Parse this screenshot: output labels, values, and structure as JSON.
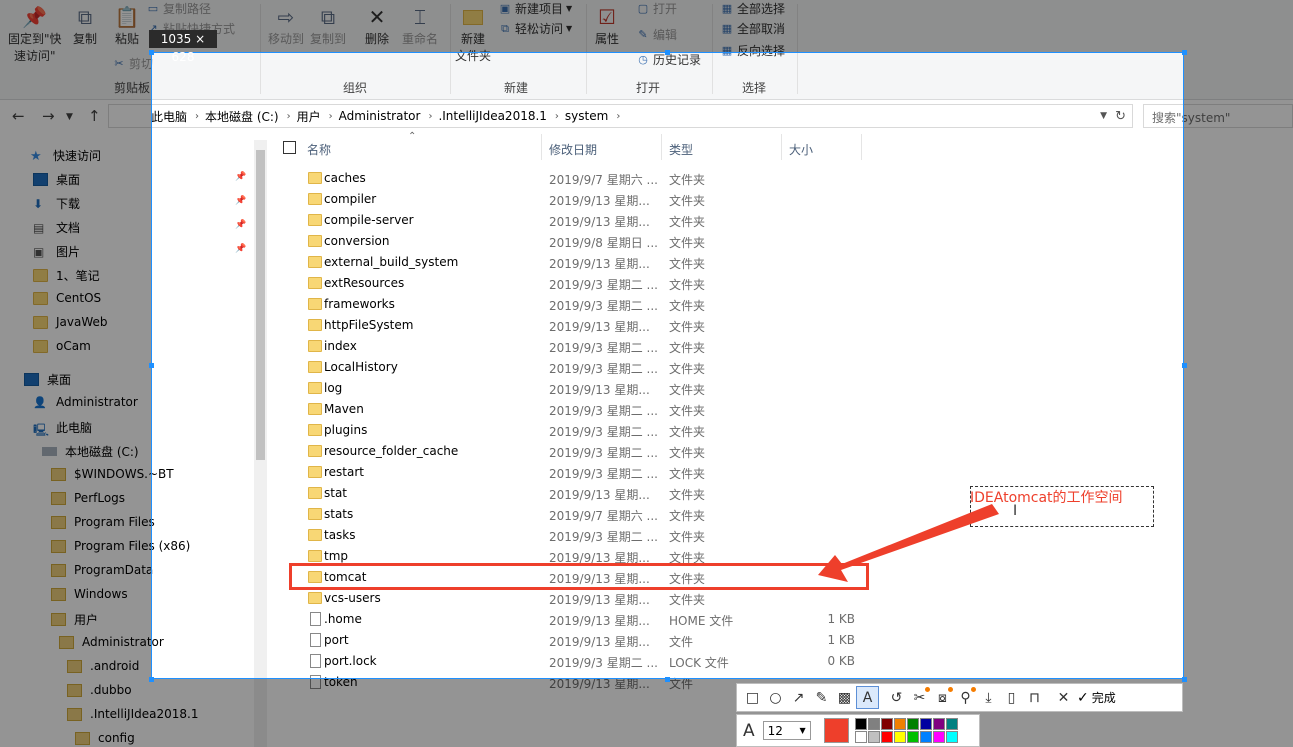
{
  "ribbon": {
    "pin_label1": "固定到\"快",
    "pin_label2": "速访问\"",
    "copy": "复制",
    "paste": "粘贴",
    "copy_path": "复制路径",
    "paste_shortcut": "粘贴快捷方式",
    "cut": "剪切",
    "clipboard_group": "剪贴板",
    "move_to": "移动到",
    "copy_to": "复制到",
    "delete": "删除",
    "rename": "重命名",
    "organize_group": "组织",
    "new_folder1": "新建",
    "new_folder2": "文件夹",
    "new_item": "新建项目",
    "easy_access": "轻松访问",
    "new_group": "新建",
    "properties": "属性",
    "open": "打开",
    "edit": "编辑",
    "history": "历史记录",
    "open_group": "打开",
    "select_all": "全部选择",
    "select_none": "全部取消",
    "invert": "反向选择",
    "select_group": "选择"
  },
  "address": {
    "crumbs": [
      "此电脑",
      "本地磁盘 (C:)",
      "用户",
      "Administrator",
      ".IntelliJIdea2018.1",
      "system"
    ],
    "search_placeholder": "搜索\"system\""
  },
  "nav": [
    {
      "label": "快速访问",
      "icon": "star-icon",
      "pinned": false
    },
    {
      "label": "桌面",
      "icon": "desktop-icon",
      "pinned": true
    },
    {
      "label": "下载",
      "icon": "download-icon",
      "pinned": true
    },
    {
      "label": "文档",
      "icon": "document-icon",
      "pinned": true
    },
    {
      "label": "图片",
      "icon": "picture-icon",
      "pinned": true
    },
    {
      "label": "1、笔记",
      "icon": "folder-icon",
      "pinned": false
    },
    {
      "label": "CentOS",
      "icon": "folder-icon",
      "pinned": false
    },
    {
      "label": "JavaWeb",
      "icon": "folder-icon",
      "pinned": false
    },
    {
      "label": "oCam",
      "icon": "folder-icon",
      "pinned": false
    },
    {
      "label": "桌面",
      "icon": "desktop-icon",
      "pinned": false
    },
    {
      "label": "Administrator",
      "icon": "user-icon",
      "pinned": false
    },
    {
      "label": "此电脑",
      "icon": "computer-icon",
      "pinned": false
    },
    {
      "label": "本地磁盘 (C:)",
      "icon": "drive-icon",
      "pinned": false
    },
    {
      "label": "$WINDOWS.~BT",
      "icon": "folder-icon",
      "pinned": false
    },
    {
      "label": "PerfLogs",
      "icon": "folder-icon",
      "pinned": false
    },
    {
      "label": "Program Files",
      "icon": "folder-icon",
      "pinned": false
    },
    {
      "label": "Program Files (x86)",
      "icon": "folder-icon",
      "pinned": false
    },
    {
      "label": "ProgramData",
      "icon": "folder-icon",
      "pinned": false
    },
    {
      "label": "Windows",
      "icon": "folder-icon",
      "pinned": false
    },
    {
      "label": "用户",
      "icon": "folder-icon",
      "pinned": false
    },
    {
      "label": "Administrator",
      "icon": "folder-icon",
      "pinned": false
    },
    {
      "label": ".android",
      "icon": "folder-icon",
      "pinned": false
    },
    {
      "label": ".dubbo",
      "icon": "folder-icon",
      "pinned": false
    },
    {
      "label": ".IntelliJIdea2018.1",
      "icon": "folder-icon",
      "pinned": false
    },
    {
      "label": "config",
      "icon": "folder-icon",
      "pinned": false
    }
  ],
  "columns": {
    "name": "名称",
    "date": "修改日期",
    "type": "类型",
    "size": "大小"
  },
  "files": [
    {
      "name": "caches",
      "date": "2019/9/7 星期六 ...",
      "type": "文件夹",
      "size": "",
      "kind": "folder"
    },
    {
      "name": "compiler",
      "date": "2019/9/13 星期...",
      "type": "文件夹",
      "size": "",
      "kind": "folder"
    },
    {
      "name": "compile-server",
      "date": "2019/9/13 星期...",
      "type": "文件夹",
      "size": "",
      "kind": "folder"
    },
    {
      "name": "conversion",
      "date": "2019/9/8 星期日 ...",
      "type": "文件夹",
      "size": "",
      "kind": "folder"
    },
    {
      "name": "external_build_system",
      "date": "2019/9/13 星期...",
      "type": "文件夹",
      "size": "",
      "kind": "folder"
    },
    {
      "name": "extResources",
      "date": "2019/9/3 星期二 ...",
      "type": "文件夹",
      "size": "",
      "kind": "folder"
    },
    {
      "name": "frameworks",
      "date": "2019/9/3 星期二 ...",
      "type": "文件夹",
      "size": "",
      "kind": "folder"
    },
    {
      "name": "httpFileSystem",
      "date": "2019/9/13 星期...",
      "type": "文件夹",
      "size": "",
      "kind": "folder"
    },
    {
      "name": "index",
      "date": "2019/9/3 星期二 ...",
      "type": "文件夹",
      "size": "",
      "kind": "folder"
    },
    {
      "name": "LocalHistory",
      "date": "2019/9/3 星期二 ...",
      "type": "文件夹",
      "size": "",
      "kind": "folder"
    },
    {
      "name": "log",
      "date": "2019/9/13 星期...",
      "type": "文件夹",
      "size": "",
      "kind": "folder"
    },
    {
      "name": "Maven",
      "date": "2019/9/3 星期二 ...",
      "type": "文件夹",
      "size": "",
      "kind": "folder"
    },
    {
      "name": "plugins",
      "date": "2019/9/3 星期二 ...",
      "type": "文件夹",
      "size": "",
      "kind": "folder"
    },
    {
      "name": "resource_folder_cache",
      "date": "2019/9/3 星期二 ...",
      "type": "文件夹",
      "size": "",
      "kind": "folder"
    },
    {
      "name": "restart",
      "date": "2019/9/3 星期二 ...",
      "type": "文件夹",
      "size": "",
      "kind": "folder"
    },
    {
      "name": "stat",
      "date": "2019/9/13 星期...",
      "type": "文件夹",
      "size": "",
      "kind": "folder"
    },
    {
      "name": "stats",
      "date": "2019/9/7 星期六 ...",
      "type": "文件夹",
      "size": "",
      "kind": "folder"
    },
    {
      "name": "tasks",
      "date": "2019/9/3 星期二 ...",
      "type": "文件夹",
      "size": "",
      "kind": "folder"
    },
    {
      "name": "tmp",
      "date": "2019/9/13 星期...",
      "type": "文件夹",
      "size": "",
      "kind": "folder"
    },
    {
      "name": "tomcat",
      "date": "2019/9/13 星期...",
      "type": "文件夹",
      "size": "",
      "kind": "folder"
    },
    {
      "name": "vcs-users",
      "date": "2019/9/13 星期...",
      "type": "文件夹",
      "size": "",
      "kind": "folder"
    },
    {
      "name": ".home",
      "date": "2019/9/13 星期...",
      "type": "HOME 文件",
      "size": "1 KB",
      "kind": "file"
    },
    {
      "name": "port",
      "date": "2019/9/13 星期...",
      "type": "文件",
      "size": "1 KB",
      "kind": "file"
    },
    {
      "name": "port.lock",
      "date": "2019/9/3 星期二 ...",
      "type": "LOCK 文件",
      "size": "0 KB",
      "kind": "file"
    },
    {
      "name": "token",
      "date": "2019/9/13 星期...",
      "type": "文件",
      "size": "",
      "kind": "file"
    }
  ],
  "capture": {
    "dimensions": "1035 × 628",
    "annotation_text": "IDEAtomcat的工作空间",
    "highlight_color": "#ee3f2b"
  },
  "toolbar": {
    "tools": [
      "rectangle-icon",
      "ellipse-icon",
      "arrow-icon",
      "pencil-icon",
      "mosaic-icon",
      "text-icon",
      "undo-icon",
      "cut-icon",
      "ocr-icon",
      "pin-icon",
      "save-icon",
      "copy-icon",
      "bookmark-icon",
      "close-icon"
    ],
    "done_label": "完成",
    "font_size": "12",
    "current_color": "#ee3f2b",
    "palette": [
      "#000000",
      "#808080",
      "#800000",
      "#f08000",
      "#008000",
      "#0000a0",
      "#800080",
      "#008080",
      "#ffffff",
      "#c0c0c0",
      "#ff0000",
      "#ffff00",
      "#00c000",
      "#0080ff",
      "#ff00ff",
      "#00ffff"
    ]
  }
}
